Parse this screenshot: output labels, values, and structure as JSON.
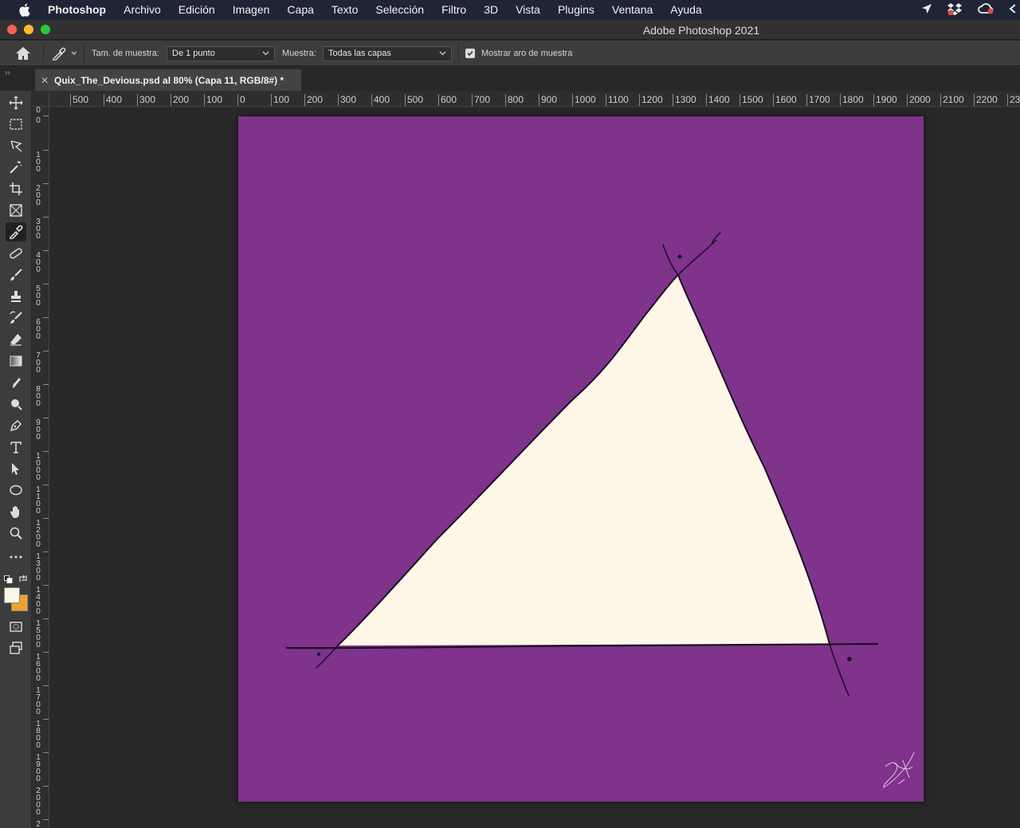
{
  "menubar": {
    "items": [
      "Photoshop",
      "Archivo",
      "Edición",
      "Imagen",
      "Capa",
      "Texto",
      "Selección",
      "Filtro",
      "3D",
      "Vista",
      "Plugins",
      "Ventana",
      "Ayuda"
    ]
  },
  "titlebar": {
    "title": "Adobe Photoshop 2021"
  },
  "options": {
    "sample_size_label": "Tam. de muestra:",
    "sample_size_value": "De 1 punto",
    "sample_label": "Muestra:",
    "sample_value": "Todas las capas",
    "show_ring_label": "Mostrar aro de muestra",
    "show_ring_checked": true
  },
  "document_tab": {
    "title": "Quix_The_Devious.psd al 80% (Capa 11, RGB/8#) *"
  },
  "rulers": {
    "horizontal": [
      "500",
      "400",
      "300",
      "200",
      "100",
      "0",
      "100",
      "200",
      "300",
      "400",
      "500",
      "600",
      "700",
      "800",
      "900",
      "1000",
      "1100",
      "1200",
      "1300",
      "1400",
      "1500",
      "1600",
      "1700",
      "1800",
      "1900",
      "2000",
      "2100",
      "2200",
      "23"
    ],
    "vertical": [
      "0",
      "0",
      "100",
      "200",
      "300",
      "400",
      "500",
      "600",
      "700",
      "800",
      "900",
      "1000",
      "1100",
      "1200",
      "1300",
      "1400",
      "1500",
      "1600",
      "1700",
      "1800",
      "1900",
      "2000",
      "2"
    ]
  },
  "tools": [
    "move-tool-icon",
    "marquee-tool-icon",
    "lasso-tool-icon",
    "magic-wand-tool-icon",
    "crop-tool-icon",
    "frame-tool-icon",
    "eyedropper-tool-icon",
    "healing-brush-tool-icon",
    "brush-tool-icon",
    "clone-stamp-tool-icon",
    "history-brush-tool-icon",
    "eraser-tool-icon",
    "gradient-tool-icon",
    "smudge-tool-icon",
    "dodge-tool-icon",
    "pen-tool-icon",
    "type-tool-icon",
    "path-selection-tool-icon",
    "ellipse-tool-icon",
    "hand-tool-icon",
    "zoom-tool-icon",
    "more-tools-icon"
  ],
  "colors": {
    "canvas_background": "#7f338a",
    "triangle_fill": "#fef7e8",
    "stroke": "#1a1024",
    "foreground": "#fdf6e6",
    "background": "#f0a32a"
  }
}
